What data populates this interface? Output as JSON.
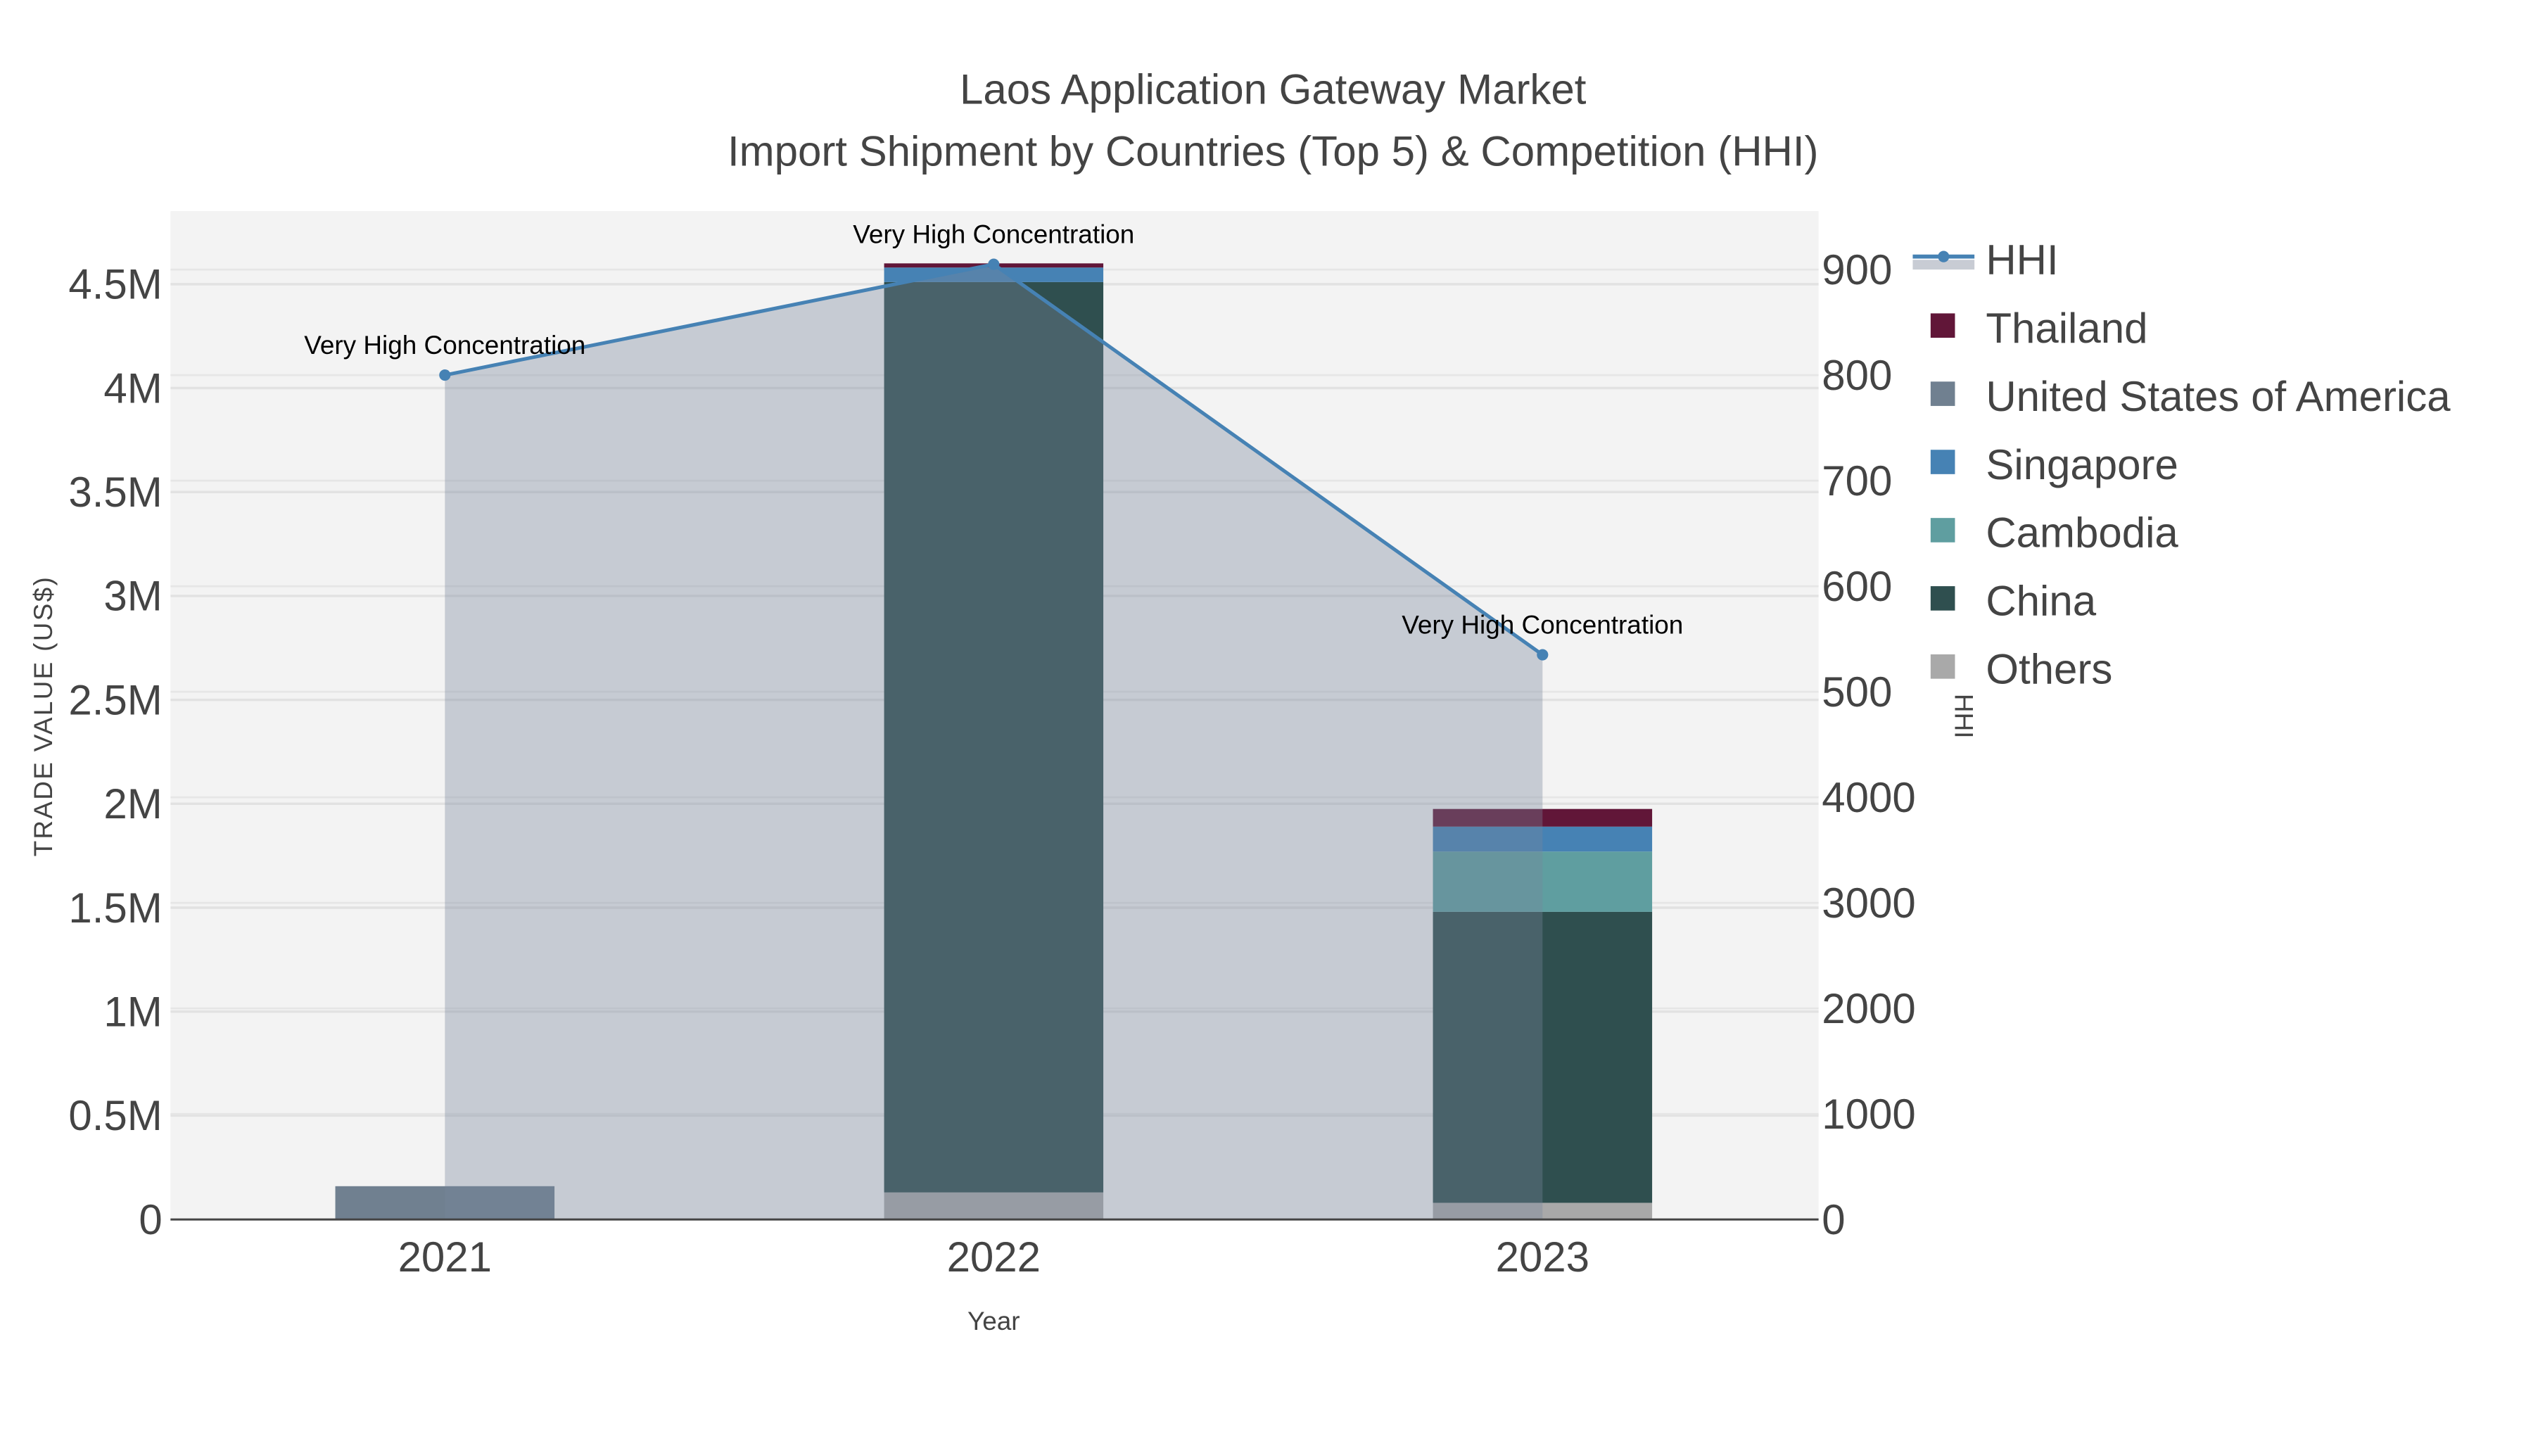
{
  "chart_data": {
    "type": "bar",
    "title": "Laos Application Gateway Market",
    "subtitle": "Import Shipment by Countries (Top 5) & Competition (HHI)",
    "xlabel": "Year",
    "ylabel": "TRADE VALUE (US$)",
    "y2label": "HHI",
    "categories": [
      "2021",
      "2022",
      "2023"
    ],
    "ylim": [
      0,
      4.85
    ],
    "y_ticks": [
      "0",
      "0.5M",
      "1M",
      "1.5M",
      "2M",
      "2.5M",
      "3M",
      "3.5M",
      "4M",
      "4.5M"
    ],
    "y2_ticks": [
      "0",
      "1000",
      "2000",
      "3000",
      "4000",
      "500",
      "600",
      "700",
      "800",
      "900"
    ],
    "y2lim": [
      0,
      950
    ],
    "stacked": true,
    "series": [
      {
        "name": "Others",
        "color": "#a9a9a9",
        "values": [
          0,
          0.13,
          0.08
        ]
      },
      {
        "name": "China",
        "color": "#2f4f4f",
        "values": [
          0,
          4.38,
          1.4
        ]
      },
      {
        "name": "Cambodia",
        "color": "#5f9ea0",
        "values": [
          0,
          0,
          0.29
        ]
      },
      {
        "name": "Singapore",
        "color": "#4682b4",
        "values": [
          0,
          0.07,
          0.12
        ]
      },
      {
        "name": "United States of America",
        "color": "#708090",
        "values": [
          0.16,
          0,
          0
        ]
      },
      {
        "name": "Thailand",
        "color": "#611638",
        "values": [
          0,
          0.02,
          0.085
        ]
      }
    ],
    "hhi": {
      "name": "HHI",
      "color": "#4682b4",
      "values": [
        800,
        905,
        535
      ],
      "annotations": [
        "Very High Concentration",
        "Very High Concentration",
        "Very High Concentration"
      ]
    },
    "legend": {
      "position": "right",
      "order": [
        "HHI",
        "Thailand",
        "United States of America",
        "Singapore",
        "Cambodia",
        "China",
        "Others"
      ]
    },
    "grid": true
  }
}
